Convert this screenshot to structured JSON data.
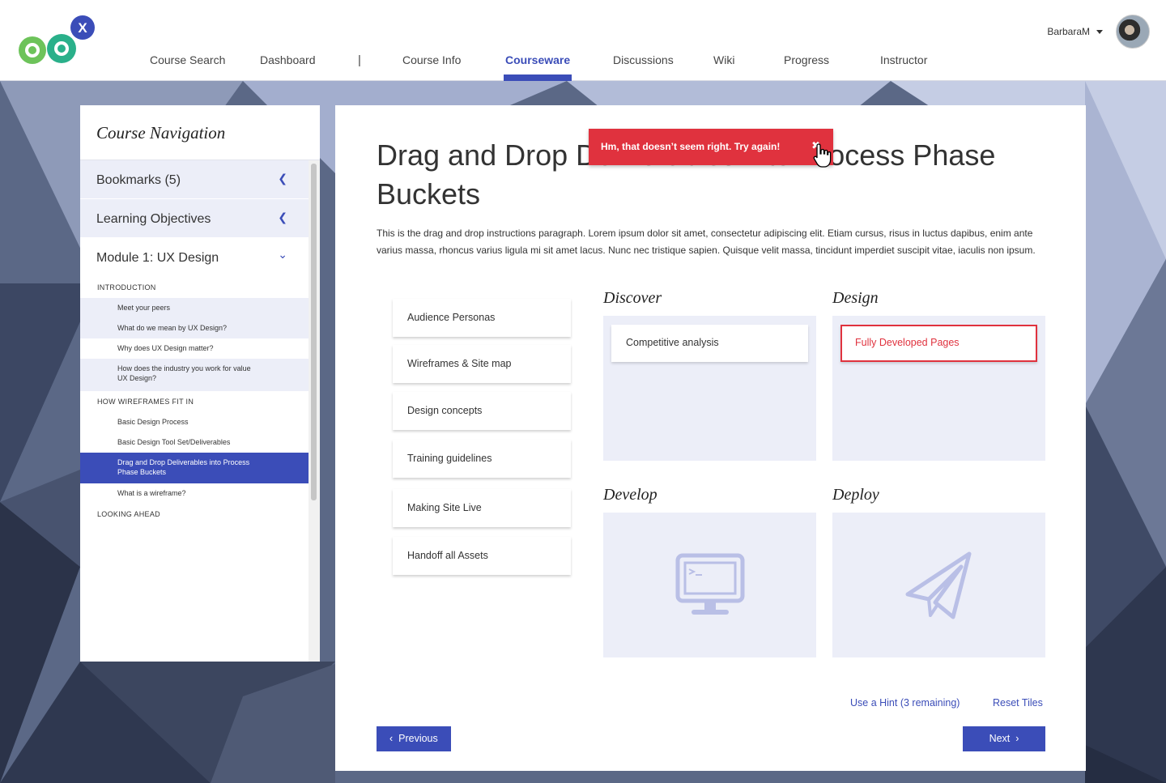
{
  "brand": {
    "accent": "#3b4db8",
    "error": "#e0323e",
    "logo_letter": "X"
  },
  "nav": {
    "items": [
      "Course Search",
      "Dashboard",
      "Course Info",
      "Courseware",
      "Discussions",
      "Wiki",
      "Progress",
      "Instructor"
    ],
    "separator": "|",
    "active": "Courseware"
  },
  "user": {
    "name": "BarbaraM"
  },
  "sidebar": {
    "title": "Course Navigation",
    "sections": [
      {
        "label": "Bookmarks (5)",
        "icon": "chevron-left-icon"
      },
      {
        "label": "Learning Objectives",
        "icon": "chevron-left-icon"
      },
      {
        "label": "Module 1: UX Design",
        "icon": "chevron-down-icon"
      }
    ],
    "groups": [
      {
        "label": "INTRODUCTION"
      },
      {
        "label": "HOW WIREFRAMES FIT IN"
      },
      {
        "label": "LOOKING AHEAD"
      }
    ],
    "links": [
      "Meet your peers",
      "What do we mean by UX Design?",
      "Why does UX Design matter?",
      "How does the industry you work for value UX Design?",
      "Basic Design Process",
      "Basic Design Tool Set/Deliverables",
      "Drag and Drop Deliverables into Process Phase Buckets",
      "What is a wireframe?"
    ]
  },
  "main": {
    "title": "Drag and Drop Deliverables into Process Phase Buckets",
    "instructions": "This is the drag and drop instructions paragraph. Lorem ipsum dolor sit amet, consectetur adipiscing elit. Etiam cursus, risus in luctus dapibus, enim ante varius massa, rhoncus varius ligula mi sit amet lacus. Nunc nec tristique sapien. Quisque velit massa, tincidunt imperdiet suscipit vitae, iaculis non ipsum.",
    "toast": {
      "message": "Hm, that doesn’t seem right. Try again!",
      "close": "✖"
    },
    "tiles": [
      "Audience Personas",
      "Wireframes & Site map",
      "Design concepts",
      "Training guidelines",
      "Making Site Live",
      "Handoff all Assets"
    ],
    "buckets": [
      {
        "name": "Discover",
        "placed": "Competitive analysis"
      },
      {
        "name": "Design",
        "placed": "Fully Developed Pages",
        "state": "incorrect"
      },
      {
        "name": "Develop",
        "icon": "monitor-icon"
      },
      {
        "name": "Deploy",
        "icon": "paper-plane-icon"
      }
    ],
    "hint_link": "Use a Hint (3 remaining)",
    "reset_link": "Reset Tiles",
    "prev_label": "Previous",
    "next_label": "Next"
  }
}
